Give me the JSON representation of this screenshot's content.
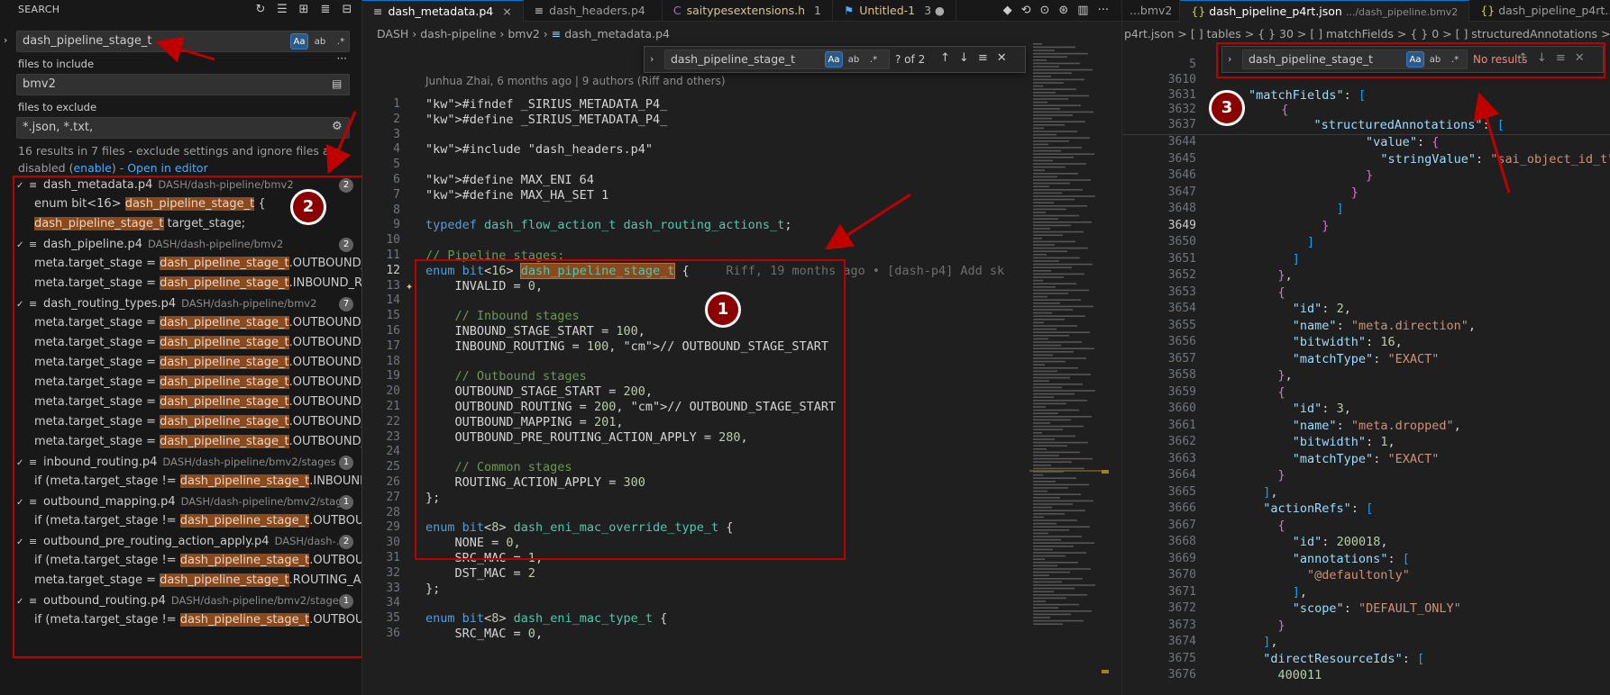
{
  "sidebar": {
    "title": "SEARCH",
    "search_value": "dash_pipeline_stage_t",
    "files_include_label": "files to include",
    "files_include_value": "bmv2",
    "files_exclude_label": "files to exclude",
    "files_exclude_value": "*.json, *.txt,",
    "summary_text": "16 results in 7 files - exclude settings and ignore files are disabled (",
    "summary_enable": "enable",
    "summary_close": ") - ",
    "summary_open_editor": "Open in editor",
    "files": [
      {
        "name": "dash_metadata.p4",
        "path": "DASH/dash-pipeline/bmv2",
        "count": "2",
        "matches": [
          {
            "pre": "enum bit<16> ",
            "hl": "dash_pipeline_stage_t",
            "post": " {"
          },
          {
            "pre": "",
            "hl": "dash_pipeline_stage_t",
            "post": " target_stage;"
          }
        ]
      },
      {
        "name": "dash_pipeline.p4",
        "path": "DASH/dash-pipeline/bmv2",
        "count": "2",
        "matches": [
          {
            "pre": "meta.target_stage = ",
            "hl": "dash_pipeline_stage_t",
            "post": ".OUTBOUND_R..."
          },
          {
            "pre": "meta.target_stage = ",
            "hl": "dash_pipeline_stage_t",
            "post": ".INBOUND_ROU..."
          }
        ]
      },
      {
        "name": "dash_routing_types.p4",
        "path": "DASH/dash-pipeline/bmv2",
        "count": "7",
        "matches": [
          {
            "pre": "meta.target_stage = ",
            "hl": "dash_pipeline_stage_t",
            "post": ".OUTBOUND_PR..."
          },
          {
            "pre": "meta.target_stage = ",
            "hl": "dash_pipeline_stage_t",
            "post": ".OUTBOUND_M..."
          },
          {
            "pre": "meta.target_stage = ",
            "hl": "dash_pipeline_stage_t",
            "post": ".OUTBOUND_M..."
          },
          {
            "pre": "meta.target_stage = ",
            "hl": "dash_pipeline_stage_t",
            "post": ".OUTBOUND_PR..."
          },
          {
            "pre": "meta.target_stage = ",
            "hl": "dash_pipeline_stage_t",
            "post": ".OUTBOUND_PR..."
          },
          {
            "pre": "meta.target_stage = ",
            "hl": "dash_pipeline_stage_t",
            "post": ".OUTBOUND_PR..."
          },
          {
            "pre": "meta.target_stage = ",
            "hl": "dash_pipeline_stage_t",
            "post": ".OUTBOUND_PR..."
          }
        ]
      },
      {
        "name": "inbound_routing.p4",
        "path": "DASH/dash-pipeline/bmv2/stages",
        "count": "1",
        "matches": [
          {
            "pre": "if (meta.target_stage != ",
            "hl": "dash_pipeline_stage_t",
            "post": ".INBOUND_R..."
          }
        ]
      },
      {
        "name": "outbound_mapping.p4",
        "path": "DASH/dash-pipeline/bmv2/stages",
        "count": "1",
        "matches": [
          {
            "pre": "if (meta.target_stage != ",
            "hl": "dash_pipeline_stage_t",
            "post": ".OUTBOUND..."
          }
        ]
      },
      {
        "name": "outbound_pre_routing_action_apply.p4",
        "path": "DASH/dash-...",
        "count": "2",
        "matches": [
          {
            "pre": "if (meta.target_stage != ",
            "hl": "dash_pipeline_stage_t",
            "post": ".OUTBOUND..."
          },
          {
            "pre": "meta.target_stage = ",
            "hl": "dash_pipeline_stage_t",
            "post": ".ROUTING_ACTI..."
          }
        ]
      },
      {
        "name": "outbound_routing.p4",
        "path": "DASH/dash-pipeline/bmv2/stages",
        "count": "1",
        "matches": [
          {
            "pre": "if (meta.target_stage != ",
            "hl": "dash_pipeline_stage_t",
            "post": ".OUTBOUND..."
          }
        ]
      }
    ]
  },
  "editor": {
    "tabs": [
      {
        "label": "dash_metadata.p4",
        "active": true,
        "suffix": "×"
      },
      {
        "label": "dash_headers.p4",
        "active": false,
        "suffix": ""
      },
      {
        "label": "saitypesextensions.h",
        "active": false,
        "suffix": "1"
      },
      {
        "label": "Untitled-1",
        "active": false,
        "suffix": "3 ●"
      }
    ],
    "breadcrumb": [
      "DASH",
      "dash-pipeline",
      "bmv2",
      "dash_metadata.p4"
    ],
    "find_value": "dash_pipeline_stage_t",
    "find_result": "? of 2",
    "blame": "Junhua Zhai, 6 months ago | 9 authors (Riff and others)",
    "inline_blame": "Riff, 19 months ago • [dash-p4] Add sk",
    "lines": [
      {
        "n": "1",
        "t": "#ifndef _SIRIUS_METADATA_P4_"
      },
      {
        "n": "2",
        "t": "#define _SIRIUS_METADATA_P4_"
      },
      {
        "n": "3",
        "t": ""
      },
      {
        "n": "4",
        "t": "#include \"dash_headers.p4\""
      },
      {
        "n": "5",
        "t": ""
      },
      {
        "n": "6",
        "t": "#define MAX_ENI 64"
      },
      {
        "n": "7",
        "t": "#define MAX_HA_SET 1"
      },
      {
        "n": "8",
        "t": ""
      },
      {
        "n": "9",
        "t": "typedef dash_flow_action_t dash_routing_actions_t;"
      },
      {
        "n": "10",
        "t": ""
      },
      {
        "n": "11",
        "t": "// Pipeline stages:"
      },
      {
        "n": "12",
        "t": "enum bit<16> dash_pipeline_stage_t {"
      },
      {
        "n": "13",
        "t": "    INVALID = 0,"
      },
      {
        "n": "14",
        "t": ""
      },
      {
        "n": "15",
        "t": "    // Inbound stages"
      },
      {
        "n": "16",
        "t": "    INBOUND_STAGE_START = 100,"
      },
      {
        "n": "17",
        "t": "    INBOUND_ROUTING = 100, // OUTBOUND_STAGE_START"
      },
      {
        "n": "18",
        "t": ""
      },
      {
        "n": "19",
        "t": "    // Outbound stages"
      },
      {
        "n": "20",
        "t": "    OUTBOUND_STAGE_START = 200,"
      },
      {
        "n": "21",
        "t": "    OUTBOUND_ROUTING = 200, // OUTBOUND_STAGE_START"
      },
      {
        "n": "22",
        "t": "    OUTBOUND_MAPPING = 201,"
      },
      {
        "n": "23",
        "t": "    OUTBOUND_PRE_ROUTING_ACTION_APPLY = 280,"
      },
      {
        "n": "24",
        "t": ""
      },
      {
        "n": "25",
        "t": "    // Common stages"
      },
      {
        "n": "26",
        "t": "    ROUTING_ACTION_APPLY = 300"
      },
      {
        "n": "27",
        "t": "};"
      },
      {
        "n": "28",
        "t": ""
      },
      {
        "n": "29",
        "t": "enum bit<8> dash_eni_mac_override_type_t {"
      },
      {
        "n": "30",
        "t": "    NONE = 0,"
      },
      {
        "n": "31",
        "t": "    SRC_MAC = 1,"
      },
      {
        "n": "32",
        "t": "    DST_MAC = 2"
      },
      {
        "n": "33",
        "t": "};"
      },
      {
        "n": "34",
        "t": ""
      },
      {
        "n": "35",
        "t": "enum bit<8> dash_eni_mac_type_t {"
      },
      {
        "n": "36",
        "t": "    SRC_MAC = 0,"
      }
    ]
  },
  "right": {
    "tabs": [
      {
        "label": "...bmv2"
      },
      {
        "label": "dash_pipeline_p4rt.json",
        "sub": ".../dash_pipeline.bmv2",
        "active": true
      },
      {
        "label": "dash_pipeline_p4rt..."
      }
    ],
    "breadcrumb": "p4rt.json > [ ] tables > { } 30 > [ ] matchFields > { } 0 > [ ] structuredAnnotations > { } 0 >",
    "find_value": "dash_pipeline_stage_t",
    "find_result": "No results",
    "sticky": [
      {
        "n": "5",
        "t": "  \"..."
      },
      {
        "n": "3610",
        "t": ""
      },
      {
        "n": "3631",
        "t": "\"matchFields\": ["
      },
      {
        "n": "3632",
        "t": "  {"
      },
      {
        "n": "3637",
        "t": "    \"structuredAnnotations\": ["
      }
    ],
    "lines": [
      {
        "n": "3644",
        "t": "                \"value\": {"
      },
      {
        "n": "3645",
        "t": "                  \"stringValue\": \"sai_object_id_t\""
      },
      {
        "n": "3646",
        "t": "                }"
      },
      {
        "n": "3647",
        "t": "              }"
      },
      {
        "n": "3648",
        "t": "            ]"
      },
      {
        "n": "3649",
        "t": "          }"
      },
      {
        "n": "3650",
        "t": "        ]"
      },
      {
        "n": "3651",
        "t": "      ]"
      },
      {
        "n": "3652",
        "t": "    },"
      },
      {
        "n": "3653",
        "t": "    {"
      },
      {
        "n": "3654",
        "t": "      \"id\": 2,"
      },
      {
        "n": "3655",
        "t": "      \"name\": \"meta.direction\","
      },
      {
        "n": "3656",
        "t": "      \"bitwidth\": 16,"
      },
      {
        "n": "3657",
        "t": "      \"matchType\": \"EXACT\""
      },
      {
        "n": "3658",
        "t": "    },"
      },
      {
        "n": "3659",
        "t": "    {"
      },
      {
        "n": "3660",
        "t": "      \"id\": 3,"
      },
      {
        "n": "3661",
        "t": "      \"name\": \"meta.dropped\","
      },
      {
        "n": "3662",
        "t": "      \"bitwidth\": 1,"
      },
      {
        "n": "3663",
        "t": "      \"matchType\": \"EXACT\""
      },
      {
        "n": "3664",
        "t": "    }"
      },
      {
        "n": "3665",
        "t": "  ],"
      },
      {
        "n": "3666",
        "t": "  \"actionRefs\": ["
      },
      {
        "n": "3667",
        "t": "    {"
      },
      {
        "n": "3668",
        "t": "      \"id\": 200018,"
      },
      {
        "n": "3669",
        "t": "      \"annotations\": ["
      },
      {
        "n": "3670",
        "t": "        \"@defaultonly\""
      },
      {
        "n": "3671",
        "t": "      ],"
      },
      {
        "n": "3672",
        "t": "      \"scope\": \"DEFAULT_ONLY\""
      },
      {
        "n": "3673",
        "t": "    }"
      },
      {
        "n": "3674",
        "t": "  ],"
      },
      {
        "n": "3675",
        "t": "  \"directResourceIds\": ["
      },
      {
        "n": "3676",
        "t": "    400011"
      }
    ]
  },
  "annotations": [
    "1",
    "2",
    "3"
  ]
}
